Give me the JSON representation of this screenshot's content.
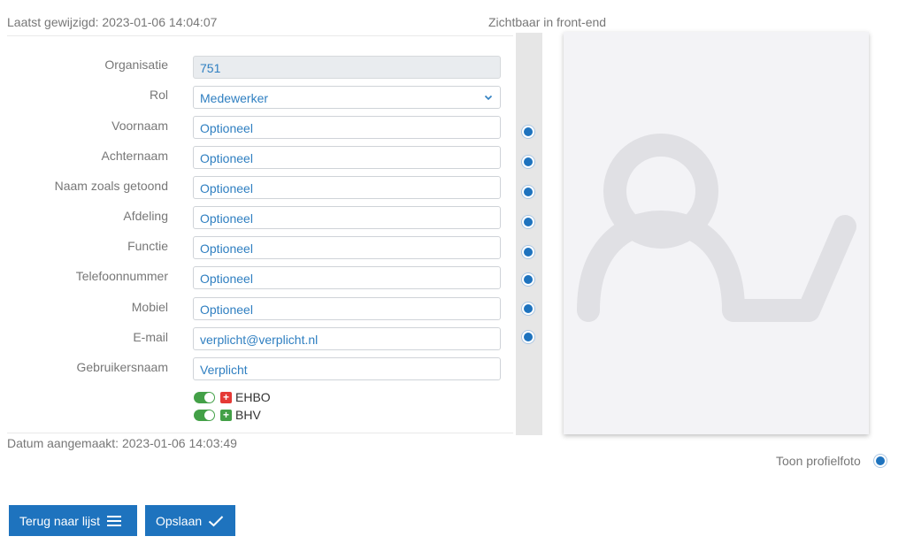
{
  "header": {
    "last_modified": "Laatst gewijzigd: 2023-01-06 14:04:07",
    "visible_frontend": "Zichtbaar in front-end"
  },
  "form": {
    "fields": [
      {
        "label": "Organisatie",
        "value": "751"
      },
      {
        "label": "Rol",
        "value": "Medewerker"
      },
      {
        "label": "Voornaam",
        "value": "Optioneel"
      },
      {
        "label": "Achternaam",
        "value": "Optioneel"
      },
      {
        "label": "Naam zoals getoond",
        "value": "Optioneel"
      },
      {
        "label": "Afdeling",
        "value": "Optioneel"
      },
      {
        "label": "Functie",
        "value": "Optioneel"
      },
      {
        "label": "Telefoonnummer",
        "value": "Optioneel"
      },
      {
        "label": "Mobiel",
        "value": "Optioneel"
      },
      {
        "label": "E-mail",
        "value": "verplicht@verplicht.nl"
      },
      {
        "label": "Gebruikersnaam",
        "value": "Verplicht"
      }
    ],
    "toggles": [
      {
        "label": "EHBO",
        "on": true,
        "color": "#e53935"
      },
      {
        "label": "BHV",
        "on": true,
        "color": "#43a047"
      }
    ]
  },
  "footer": {
    "created": "Datum aangemaakt: 2023-01-06 14:03:49",
    "show_photo": "Toon profielfoto"
  },
  "actions": {
    "back_label": "Terug naar lijst",
    "save_label": "Opslaan"
  },
  "colors": {
    "accent": "#1e73be",
    "toggle_on": "#43a047"
  }
}
